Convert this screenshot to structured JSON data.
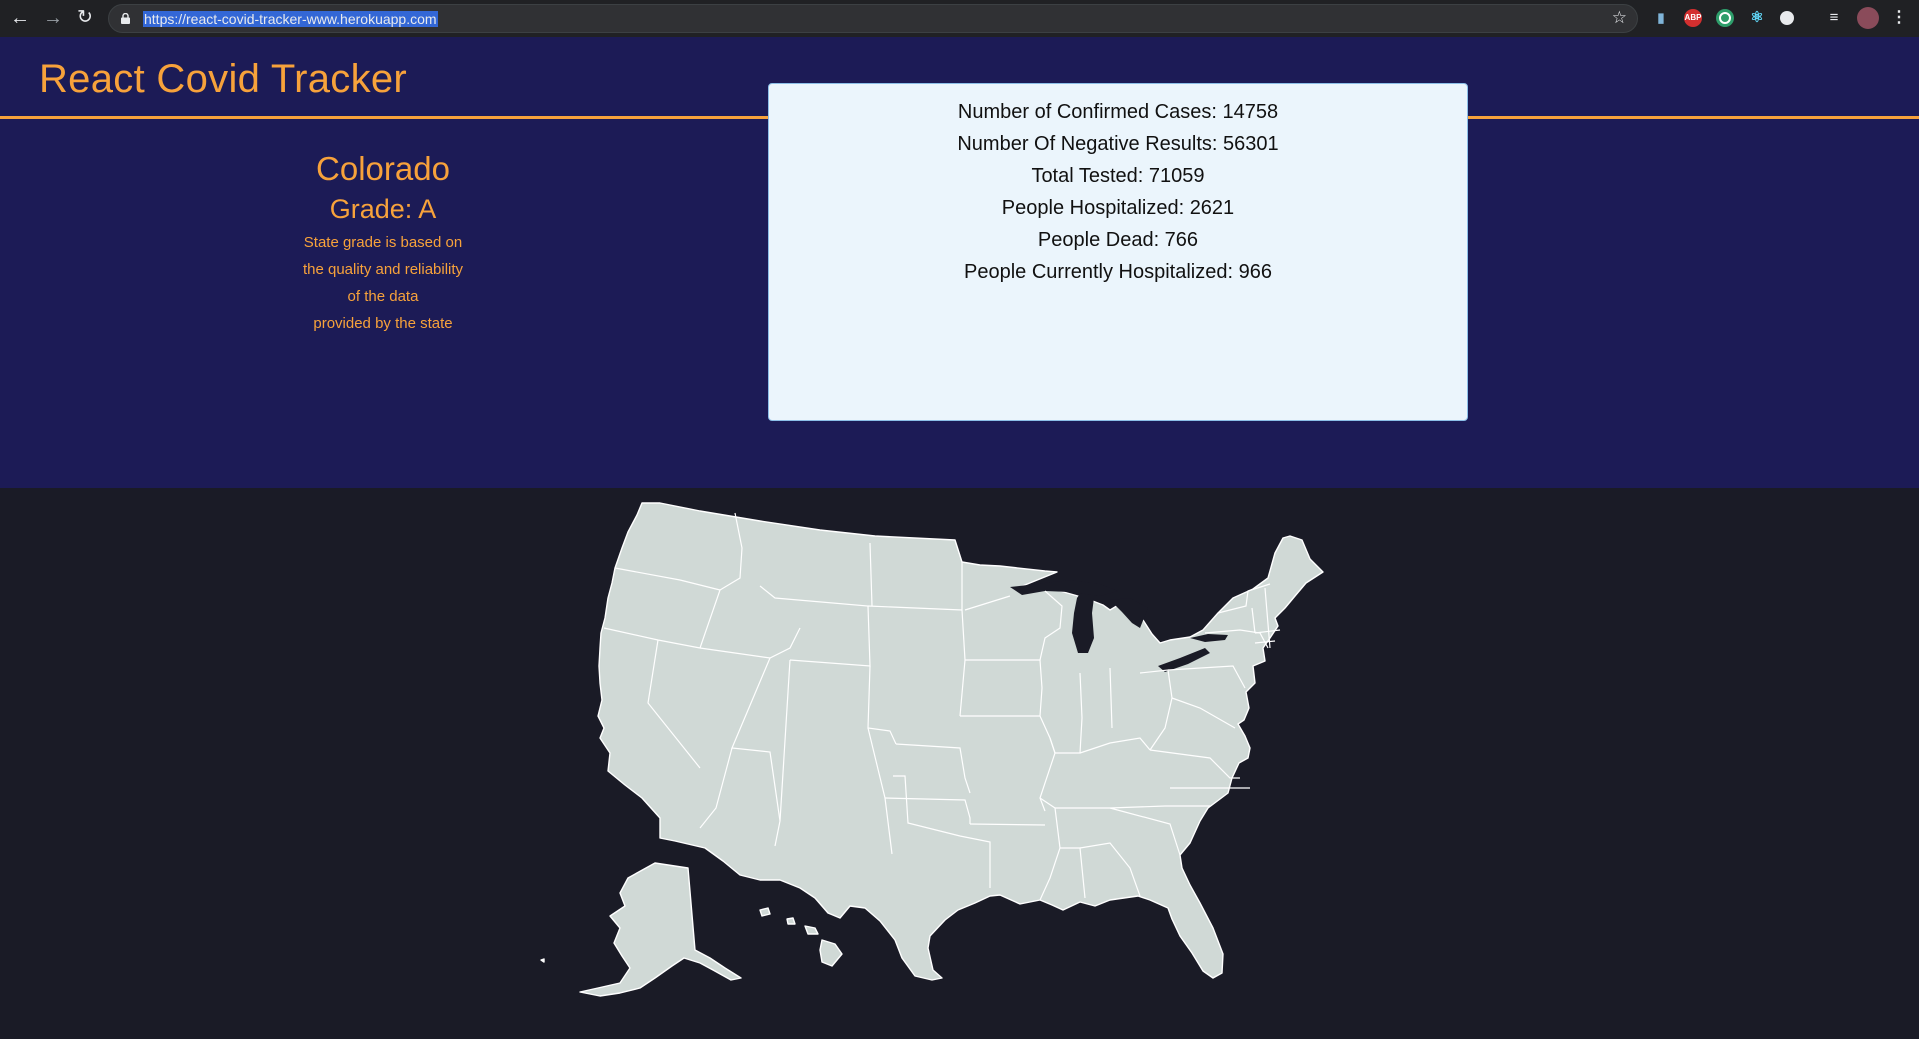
{
  "browser": {
    "url": "https://react-covid-tracker-www.herokuapp.com",
    "icons": [
      "back-arrow-icon",
      "forward-arrow-icon",
      "reload-icon",
      "lock-icon",
      "bookmark-star-icon",
      "bar-chart-extension-icon",
      "adblock-extension-icon",
      "circle-extension-icon",
      "react-devtools-icon",
      "dark-mode-extension-icon",
      "reading-list-icon",
      "profile-avatar",
      "menu-dots-icon"
    ],
    "adblock_label": "ABP"
  },
  "header": {
    "title": "React Covid Tracker"
  },
  "state": {
    "name": "Colorado",
    "grade": "Grade: A",
    "note_lines": [
      "State grade is based on",
      "the quality and reliability",
      "of the data",
      "provided by the state"
    ]
  },
  "stats": [
    "Number of Confirmed Cases: 14758",
    "Number Of Negative Results: 56301",
    "Total Tested: 71059",
    "People Hospitalized: 2621",
    "People Dead: 766",
    "People Currently Hospitalized: 966"
  ],
  "colors": {
    "accent": "#f7a23b",
    "header_bg": "#1c1b56",
    "page_bg": "#1a1b26",
    "card_bg": "#ebf5fc",
    "map_fill": "#d0d9d6"
  }
}
